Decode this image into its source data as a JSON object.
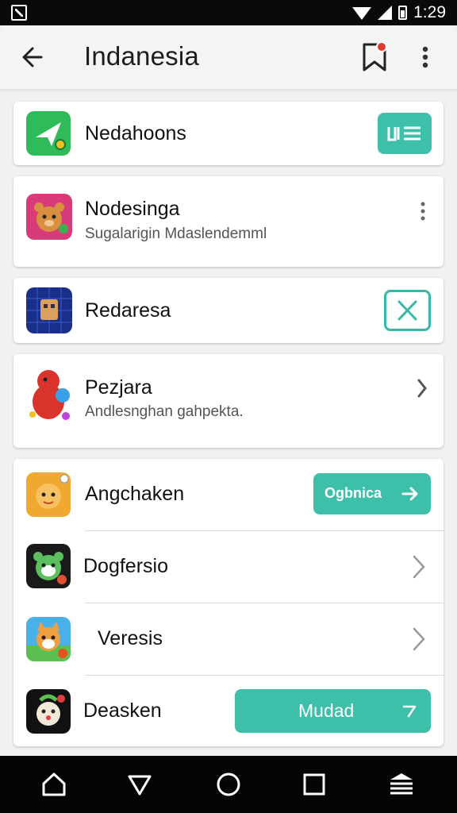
{
  "status_bar": {
    "time": "1:29",
    "icons": [
      "notification-icon",
      "wifi-icon",
      "signal-icon",
      "battery-icon"
    ]
  },
  "app_bar": {
    "title": "Indanesia",
    "icons": [
      "back-arrow-icon",
      "bookmark-icon",
      "more-vert-icon"
    ]
  },
  "cards": [
    {
      "name": "Nedahoons",
      "action": "list-view",
      "icon": "paper-plane-icon"
    },
    {
      "name": "Nodesinga",
      "subtitle": "Sugalarigin Mdaslendemml",
      "action": "more",
      "icon": "bear-icon"
    },
    {
      "name": "Redaresa",
      "action": "close",
      "icon": "robot-icon"
    },
    {
      "name": "Pezjara",
      "subtitle": "Andlesnghan gahpekta.",
      "action": "chevron",
      "icon": "bird-icon"
    }
  ],
  "list": [
    {
      "name": "Angchaken",
      "button_label": "Ogbnica",
      "icon": "tiger-icon"
    },
    {
      "name": "Dogfersio",
      "icon": "panda-icon"
    },
    {
      "name": "Veresis",
      "icon": "fox-icon"
    },
    {
      "name": "Deasken",
      "button_label": "Mudad",
      "icon": "monkey-icon"
    }
  ],
  "colors": {
    "accent": "#3dbfaa",
    "status_bar": "#0a0a0a",
    "nav_bar": "#050505",
    "badge": "#e23b2e"
  },
  "nav_bar": [
    "home-icon",
    "back-icon",
    "circle-icon",
    "recents-icon",
    "menu-icon"
  ]
}
